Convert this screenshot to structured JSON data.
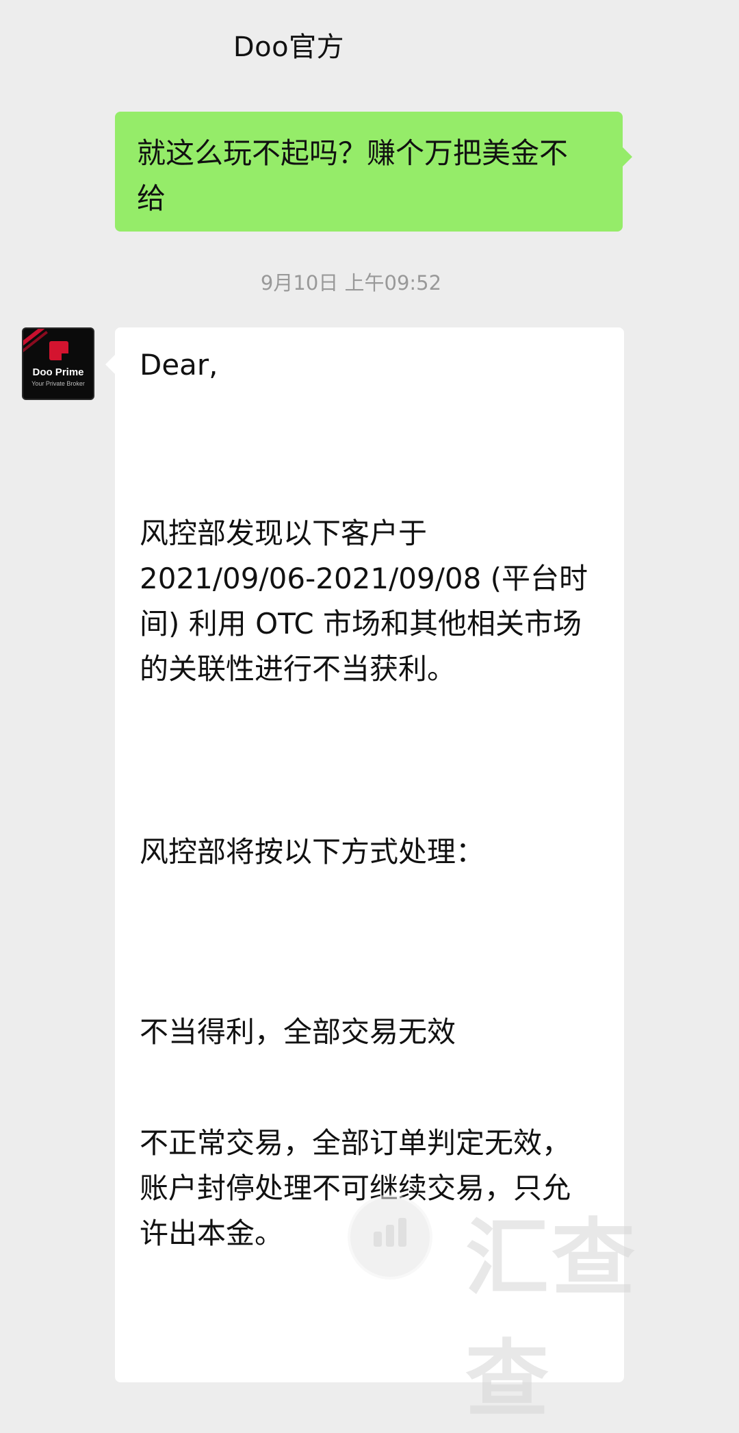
{
  "header": {
    "title": "Doo官方"
  },
  "messages": {
    "sent": {
      "line1": "就这么玩不起吗？赚个万把美金不",
      "line2": "给"
    },
    "timestamp": "9月10日 上午09:52",
    "received": {
      "sender_avatar": {
        "brand": "Doo Prime",
        "tagline": "Your Private Broker"
      },
      "lines": [
        "Dear,",
        "风控部发现以下客户于",
        "2021/09/06-2021/09/08 (平台时",
        "间) 利用 OTC 市场和其他相关市场",
        "的关联性进行不当获利。",
        "风控部将按以下方式处理：",
        "不当得利，全部交易无效",
        "不正常交易，全部订单判定无效，",
        "账户封停处理不可继续交易，只允",
        "许出本金。"
      ]
    }
  },
  "watermark": {
    "text": "汇查查"
  },
  "colors": {
    "background": "#ededed",
    "sent_bubble": "#95ec69",
    "received_bubble": "#ffffff",
    "timestamp": "#999999"
  }
}
